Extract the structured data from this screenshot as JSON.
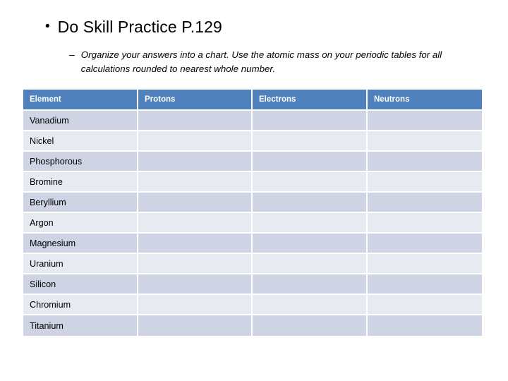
{
  "slide": {
    "title_bullet": {
      "marker": "•",
      "text": "Do Skill Practice P.129"
    },
    "sub_bullet": {
      "marker": "–",
      "text": "Organize your answers into a chart. Use the atomic mass on your periodic tables for all calculations rounded to nearest whole number."
    },
    "colors": {
      "header_background": "#4F81BD",
      "header_text": "#FFFFFF",
      "row_band_dark": "#CED4E3",
      "row_band_light": "#E7EAF1",
      "body_text": "#000000",
      "slide_background": "#FFFFFF"
    }
  },
  "table": {
    "headers": [
      "Element",
      "Protons",
      "Electrons",
      "Neutrons"
    ],
    "rows": [
      {
        "element": "Vanadium",
        "protons": "",
        "electrons": "",
        "neutrons": ""
      },
      {
        "element": "Nickel",
        "protons": "",
        "electrons": "",
        "neutrons": ""
      },
      {
        "element": "Phosphorous",
        "protons": "",
        "electrons": "",
        "neutrons": ""
      },
      {
        "element": "Bromine",
        "protons": "",
        "electrons": "",
        "neutrons": ""
      },
      {
        "element": "Beryllium",
        "protons": "",
        "electrons": "",
        "neutrons": ""
      },
      {
        "element": "Argon",
        "protons": "",
        "electrons": "",
        "neutrons": ""
      },
      {
        "element": "Magnesium",
        "protons": "",
        "electrons": "",
        "neutrons": ""
      },
      {
        "element": "Uranium",
        "protons": "",
        "electrons": "",
        "neutrons": ""
      },
      {
        "element": "Silicon",
        "protons": "",
        "electrons": "",
        "neutrons": ""
      },
      {
        "element": "Chromium",
        "protons": "",
        "electrons": "",
        "neutrons": ""
      },
      {
        "element": "Titanium",
        "protons": "",
        "electrons": "",
        "neutrons": ""
      }
    ]
  }
}
